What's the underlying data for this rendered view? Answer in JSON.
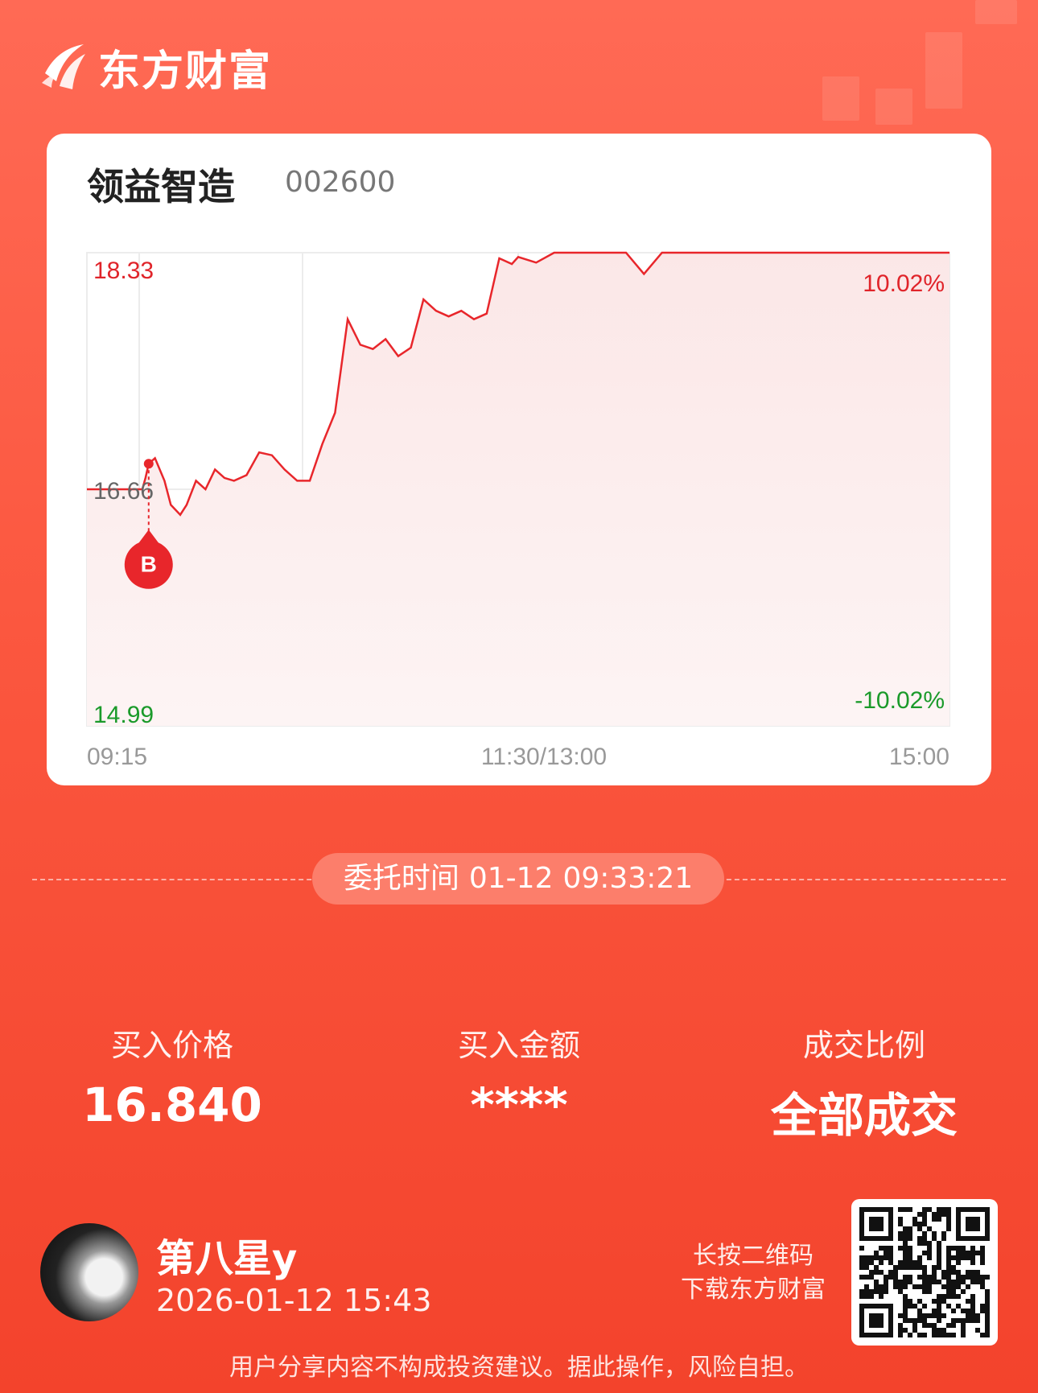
{
  "brand": {
    "name": "东方财富"
  },
  "stock": {
    "name": "领益智造",
    "code": "002600"
  },
  "chart_data": {
    "type": "line",
    "title": "",
    "price_high": "18.33",
    "price_mid": "16.66",
    "price_low": "14.99",
    "pct_high": "10.02%",
    "pct_low": "-10.02%",
    "time_labels": [
      "09:15",
      "11:30/13:00",
      "15:00"
    ],
    "ylim": [
      14.99,
      18.33
    ],
    "prev_close": 16.66,
    "buy_marker": {
      "label": "B",
      "time": "09:33",
      "price": 16.84
    },
    "x": [
      "09:15",
      "09:30",
      "09:31",
      "09:32",
      "09:33",
      "09:35",
      "09:38",
      "09:40",
      "09:43",
      "09:45",
      "09:48",
      "09:51",
      "09:54",
      "09:57",
      "10:00",
      "10:04",
      "10:08",
      "10:12",
      "10:16",
      "10:20",
      "10:24",
      "10:28",
      "10:32",
      "10:36",
      "10:40",
      "10:44",
      "10:48",
      "10:52",
      "10:56",
      "11:00",
      "11:04",
      "11:08",
      "11:12",
      "11:16",
      "11:20",
      "11:24",
      "11:28",
      "11:30",
      "13:05",
      "13:10",
      "13:15",
      "13:20",
      "13:25",
      "13:30",
      "13:35",
      "13:40",
      "13:45",
      "13:50",
      "13:55",
      "14:00",
      "14:30",
      "15:00"
    ],
    "values": [
      16.66,
      16.66,
      16.66,
      16.74,
      16.84,
      16.88,
      16.72,
      16.55,
      16.48,
      16.55,
      16.72,
      16.66,
      16.8,
      16.74,
      16.72,
      16.76,
      16.92,
      16.9,
      16.8,
      16.72,
      16.72,
      16.98,
      17.2,
      17.86,
      17.68,
      17.65,
      17.72,
      17.6,
      17.66,
      18.0,
      17.92,
      17.88,
      17.92,
      17.86,
      17.9,
      18.29,
      18.25,
      18.3,
      18.26,
      18.33,
      18.33,
      18.33,
      18.33,
      18.33,
      18.18,
      18.33,
      18.33,
      18.33,
      18.33,
      18.33,
      18.33,
      18.33
    ],
    "grid": true
  },
  "order": {
    "label": "委托时间",
    "date": "01-12",
    "time": "09:33:21"
  },
  "stats": [
    {
      "label": "买入价格",
      "value": "16.840"
    },
    {
      "label": "买入金额",
      "value": "****"
    },
    {
      "label": "成交比例",
      "value": "全部成交"
    }
  ],
  "user": {
    "name": "第八星y",
    "time": "2026-01-12 15:43"
  },
  "qr": {
    "line1": "长按二维码",
    "line2": "下载东方财富"
  },
  "disclaimer": "用户分享内容不构成投资建议。据此操作，风险自担。"
}
